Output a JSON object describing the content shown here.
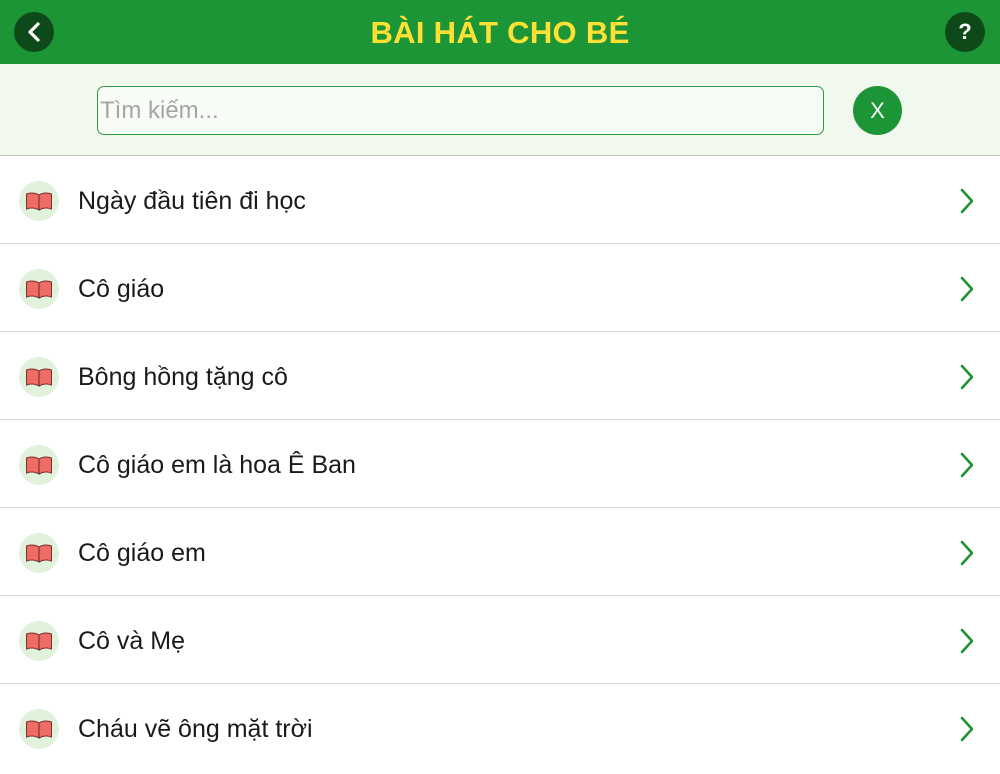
{
  "header": {
    "title": "BÀI HÁT CHO BÉ",
    "back_icon": "chevron-left-icon",
    "help_icon": "question-icon",
    "help_label": "?",
    "colors": {
      "bar": "#1c9537",
      "title": "#ffe033",
      "button": "#0e4a19"
    }
  },
  "search": {
    "placeholder": "Tìm kiếm...",
    "value": "",
    "clear_label": "X"
  },
  "songs": [
    {
      "title": "Ngày đầu tiên đi học",
      "icon": "open-book-icon"
    },
    {
      "title": "Cô giáo",
      "icon": "open-book-icon"
    },
    {
      "title": "Bông hồng tặng cô",
      "icon": "open-book-icon"
    },
    {
      "title": "Cô giáo em là hoa Ê Ban",
      "icon": "open-book-icon"
    },
    {
      "title": "Cô giáo em",
      "icon": "open-book-icon"
    },
    {
      "title": "Cô và Mẹ",
      "icon": "open-book-icon"
    },
    {
      "title": "Cháu vẽ ông mặt trời",
      "icon": "open-book-icon"
    }
  ],
  "colors": {
    "accent": "#1c9537",
    "chevron": "#1c9537",
    "book": "#f06b63"
  }
}
